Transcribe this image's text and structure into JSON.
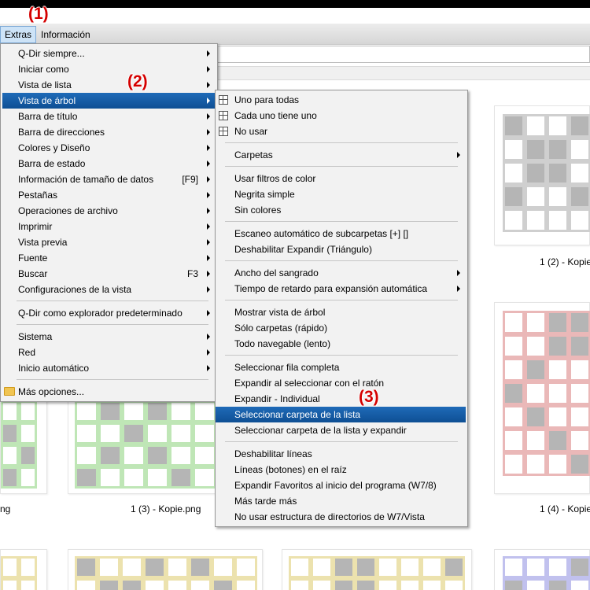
{
  "annotations": [
    "(1)",
    "(2)",
    "(3)"
  ],
  "menubar": {
    "items": [
      "Extras",
      "Información"
    ]
  },
  "extras_menu": {
    "items": [
      {
        "label": "Q-Dir siempre...",
        "shortcut": "",
        "submenu": true
      },
      {
        "label": "Iniciar como",
        "shortcut": "",
        "submenu": true
      },
      {
        "label": "Vista de lista",
        "shortcut": "",
        "submenu": true
      },
      {
        "label": "Vista de árbol",
        "shortcut": "",
        "submenu": true
      },
      {
        "label": "Barra de título",
        "shortcut": "",
        "submenu": true
      },
      {
        "label": "Barra de direcciones",
        "shortcut": "",
        "submenu": true
      },
      {
        "label": "Colores y Diseño",
        "shortcut": "",
        "submenu": true
      },
      {
        "label": "Barra de estado",
        "shortcut": "",
        "submenu": true
      },
      {
        "label": "Información de tamaño de datos",
        "shortcut": "[F9]",
        "submenu": true
      },
      {
        "label": "Pestañas",
        "shortcut": "",
        "submenu": true
      },
      {
        "label": "Operaciones de archivo",
        "shortcut": "",
        "submenu": true
      },
      {
        "label": "Imprimir",
        "shortcut": "",
        "submenu": true
      },
      {
        "label": "Vista previa",
        "shortcut": "",
        "submenu": true
      },
      {
        "label": "Fuente",
        "shortcut": "",
        "submenu": true
      },
      {
        "label": "Buscar",
        "shortcut": "F3",
        "submenu": true
      },
      {
        "label": "Configuraciones de la vista",
        "shortcut": "",
        "submenu": true
      },
      {
        "label": "Q-Dir como explorador predeterminado",
        "shortcut": "",
        "submenu": true
      },
      {
        "label": "Sistema",
        "shortcut": "",
        "submenu": true
      },
      {
        "label": "Red",
        "shortcut": "",
        "submenu": true
      },
      {
        "label": "Inicio automático",
        "shortcut": "",
        "submenu": true
      },
      {
        "label": "Más opciones...",
        "shortcut": "",
        "submenu": false
      }
    ],
    "highlighted": "Vista de árbol"
  },
  "tree_menu": {
    "items": [
      {
        "label": "Uno para todas",
        "submenu": false
      },
      {
        "label": "Cada uno tiene uno",
        "submenu": false
      },
      {
        "label": "No usar",
        "submenu": false
      },
      {
        "label": "Carpetas",
        "submenu": true
      },
      {
        "label": "Usar filtros de color",
        "submenu": false
      },
      {
        "label": "Negrita simple",
        "submenu": false
      },
      {
        "label": "Sin colores",
        "submenu": false
      },
      {
        "label": "Escaneo automático de subcarpetas [+] []",
        "submenu": false
      },
      {
        "label": "Deshabilitar Expandir (Triángulo)",
        "submenu": false
      },
      {
        "label": "Ancho del sangrado",
        "submenu": true
      },
      {
        "label": "Tiempo de retardo para expansión automática",
        "submenu": true
      },
      {
        "label": "Mostrar vista de árbol",
        "submenu": false
      },
      {
        "label": "Sólo carpetas (rápido)",
        "submenu": false
      },
      {
        "label": "Todo navegable (lento)",
        "submenu": false
      },
      {
        "label": "Seleccionar fila completa",
        "submenu": false
      },
      {
        "label": "Expandir al seleccionar con el ratón",
        "submenu": false
      },
      {
        "label": "Expandir - Individual",
        "submenu": false
      },
      {
        "label": "Seleccionar carpeta de la lista",
        "submenu": false
      },
      {
        "label": "Seleccionar carpeta de la lista y expandir",
        "submenu": false
      },
      {
        "label": "Deshabilitar líneas",
        "submenu": false
      },
      {
        "label": "Líneas (botones) en el raíz",
        "submenu": false
      },
      {
        "label": "Expandir Favoritos al inicio del programa (W7/8)",
        "submenu": false
      },
      {
        "label": "Más tarde más",
        "submenu": false
      },
      {
        "label": "No usar estructura de directorios de W7/Vista",
        "submenu": false
      }
    ],
    "highlighted": "Seleccionar carpeta de la lista"
  },
  "thumbnails": {
    "captions": [
      "1 (2) - Kopie",
      "ng",
      "1 (3) - Kopie.png",
      "1 (4) - Kopie"
    ],
    "colors": {
      "gray": "#cfcfcf",
      "red": "#eab8b8",
      "green": "#bfe6b6",
      "yellow": "#ece2ae",
      "blue": "#c1c1ee",
      "fill": "#b5b5b5"
    }
  }
}
